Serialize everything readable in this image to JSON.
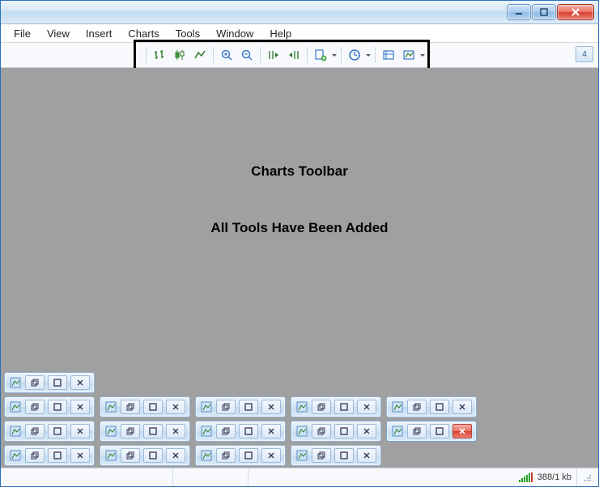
{
  "menu": {
    "file": "File",
    "view": "View",
    "insert": "Insert",
    "charts": "Charts",
    "tools": "Tools",
    "window": "Window",
    "help": "Help"
  },
  "annotations": {
    "toolbar_label": "Charts Toolbar",
    "body_text": "All Tools Have Been Added"
  },
  "badge": {
    "count": "4"
  },
  "status": {
    "transfer": "388/1 kb"
  }
}
